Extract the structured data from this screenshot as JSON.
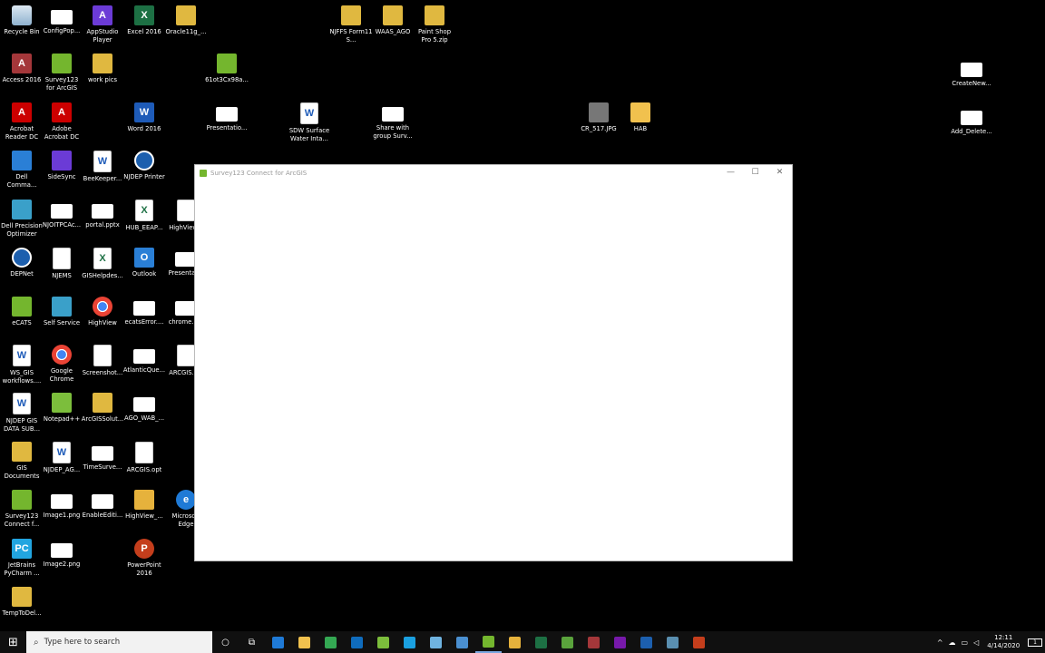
{
  "desktop": {
    "icons": [
      {
        "label": "Recycle Bin",
        "icon": "recycle-bin-icon"
      },
      {
        "label": "ConfigPop...",
        "icon": "image-file-icon"
      },
      {
        "label": "AppStudio Player",
        "icon": "appstudio-icon"
      },
      {
        "label": "Excel 2016",
        "icon": "excel-icon"
      },
      {
        "label": "Oracle11g_...",
        "icon": "zip-file-icon"
      },
      {
        "label": "NJFFS Form11 S...",
        "icon": "zip-file-icon"
      },
      {
        "label": "WAAS_AGO",
        "icon": "zip-file-icon"
      },
      {
        "label": "Paint Shop Pro 5.zip",
        "icon": "zip-file-icon"
      },
      {
        "label": "Access 2016",
        "icon": "access-icon"
      },
      {
        "label": "Survey123 for ArcGIS",
        "icon": "survey123-icon"
      },
      {
        "label": "work pics",
        "icon": "zip-file-icon"
      },
      {
        "label": "61ot3Cx98a...",
        "icon": "survey123-icon"
      },
      {
        "label": "CreateNew...",
        "icon": "image-file-icon"
      },
      {
        "label": "Acrobat Reader DC",
        "icon": "pdf-icon"
      },
      {
        "label": "Adobe Acrobat DC",
        "icon": "pdf-icon"
      },
      {
        "label": "Word 2016",
        "icon": "word-icon"
      },
      {
        "label": "Presentatio...",
        "icon": "image-file-icon"
      },
      {
        "label": "SDW Surface Water Inta...",
        "icon": "word-doc-icon"
      },
      {
        "label": "Share with group Surv...",
        "icon": "image-file-icon"
      },
      {
        "label": "CR_517.JPG",
        "icon": "photo-icon"
      },
      {
        "label": "HAB",
        "icon": "folder-icon"
      },
      {
        "label": "Add_Delete...",
        "icon": "image-file-icon"
      },
      {
        "label": "Dell Comma...",
        "icon": "dell-command-icon"
      },
      {
        "label": "SideSync",
        "icon": "sidesync-icon"
      },
      {
        "label": "BeeKeeper...",
        "icon": "word-doc-icon"
      },
      {
        "label": "NJDEP Printer",
        "icon": "globe-shortcut-icon"
      },
      {
        "label": "Dell Precision Optimizer",
        "icon": "dell-optimizer-icon"
      },
      {
        "label": "NJOITPCAc...",
        "icon": "image-file-icon"
      },
      {
        "label": "portal.pptx",
        "icon": "image-file-icon"
      },
      {
        "label": "HUB_EEAP...",
        "icon": "excel-doc-icon"
      },
      {
        "label": "HighView...",
        "icon": "document-icon"
      },
      {
        "label": "DEPNet",
        "icon": "globe-shortcut-icon"
      },
      {
        "label": "NJEMS",
        "icon": "document-icon"
      },
      {
        "label": "GISHelpdes...",
        "icon": "excel-doc-icon"
      },
      {
        "label": "Outlook",
        "icon": "outlook-icon"
      },
      {
        "label": "Presentat...",
        "icon": "image-file-icon"
      },
      {
        "label": "eCATS",
        "icon": "ecats-icon"
      },
      {
        "label": "Self Service",
        "icon": "self-service-icon"
      },
      {
        "label": "HighView",
        "icon": "chrome-icon"
      },
      {
        "label": "ecatsError....",
        "icon": "image-file-icon"
      },
      {
        "label": "chrome.p...",
        "icon": "image-file-icon"
      },
      {
        "label": "WS_GIS workflows....",
        "icon": "word-doc-icon"
      },
      {
        "label": "Google Chrome",
        "icon": "chrome-icon"
      },
      {
        "label": "Screenshot...",
        "icon": "document-icon"
      },
      {
        "label": "AtlanticQue...",
        "icon": "image-file-icon"
      },
      {
        "label": "ARCGIS.s...",
        "icon": "document-icon"
      },
      {
        "label": "NJDEP GIS DATA SUB...",
        "icon": "word-doc-icon"
      },
      {
        "label": "Notepad++",
        "icon": "notepad-plus-icon"
      },
      {
        "label": "ArcGISSolut...",
        "icon": "zip-file-icon"
      },
      {
        "label": "AGO_WAB_...",
        "icon": "image-file-icon"
      },
      {
        "label": "GIS Documents",
        "icon": "zip-file-icon"
      },
      {
        "label": "NJDEP_AG...",
        "icon": "word-doc-icon"
      },
      {
        "label": "TimeSurve...",
        "icon": "image-file-icon"
      },
      {
        "label": "ARCGIS.opt",
        "icon": "document-icon"
      },
      {
        "label": "Survey123 Connect f...",
        "icon": "survey123-icon"
      },
      {
        "label": "Image1.png",
        "icon": "image-file-icon"
      },
      {
        "label": "EnableEditi...",
        "icon": "image-file-icon"
      },
      {
        "label": "HighView_...",
        "icon": "help-file-icon"
      },
      {
        "label": "Microsoft Edge",
        "icon": "edge-icon"
      },
      {
        "label": "JetBrains PyCharm ...",
        "icon": "pycharm-icon"
      },
      {
        "label": "Image2.png",
        "icon": "image-file-icon"
      },
      {
        "label": "PowerPoint 2016",
        "icon": "powerpoint-icon"
      },
      {
        "label": "TempToDel...",
        "icon": "zip-file-icon"
      }
    ]
  },
  "window": {
    "title": "Survey123 Connect for ArcGIS",
    "minimize": "—",
    "maximize": "☐",
    "close": "✕",
    "accent": "#74b62e"
  },
  "taskbar": {
    "start_glyph": "⊞",
    "search_placeholder": "Type here to search",
    "cortana_glyph": "○",
    "taskview_glyph": "⧉",
    "apps": [
      {
        "name": "edge",
        "color": "#1f7ad6"
      },
      {
        "name": "file-explorer",
        "color": "#f1c14e"
      },
      {
        "name": "chrome",
        "color": "#34a853"
      },
      {
        "name": "outlook",
        "color": "#0f6cbd"
      },
      {
        "name": "notepad-plus",
        "color": "#7cbe3c"
      },
      {
        "name": "skype",
        "color": "#1aa0e0"
      },
      {
        "name": "paint",
        "color": "#6fb3e0"
      },
      {
        "name": "arcgis-pro",
        "color": "#4a8fd0"
      },
      {
        "name": "survey123",
        "color": "#74b62e"
      },
      {
        "name": "folder-zip",
        "color": "#e6b23c"
      },
      {
        "name": "excel",
        "color": "#1d7044"
      },
      {
        "name": "notepad-green",
        "color": "#5aa33c"
      },
      {
        "name": "access",
        "color": "#a4373a"
      },
      {
        "name": "onenote",
        "color": "#7719aa"
      },
      {
        "name": "globe-shortcut",
        "color": "#1c5fae"
      },
      {
        "name": "magnifier",
        "color": "#5a8fb0"
      },
      {
        "name": "powerpoint",
        "color": "#c43e1c"
      }
    ],
    "tray": {
      "chevron": "^",
      "time": "12:11",
      "date": "4/14/2020",
      "notifications": "1"
    }
  }
}
